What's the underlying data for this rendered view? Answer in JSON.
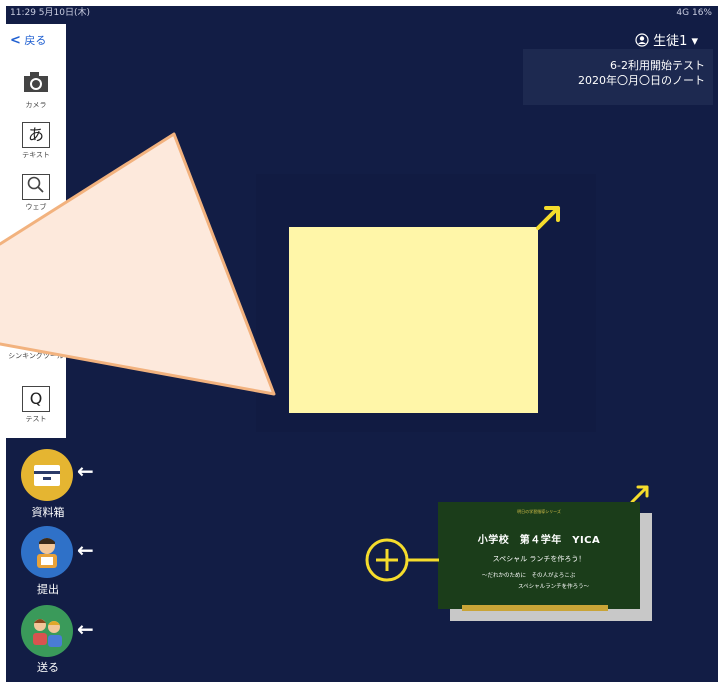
{
  "status": {
    "time": "11:29 5月10日(木)",
    "right": "4G 16%"
  },
  "nav": {
    "back": "戻る"
  },
  "user": {
    "name": "生徒1 ▾"
  },
  "note": {
    "title": "6-2利用開始テスト",
    "date": "2020年〇月〇日のノート"
  },
  "tools": [
    {
      "label": "カメラ",
      "icon": "camera-icon"
    },
    {
      "label": "テキスト",
      "icon": "text-a-icon"
    },
    {
      "label": "ウェブ",
      "icon": "magnifier-icon"
    },
    {
      "label": "シンキングツール",
      "icon": "thinking-tool-icon"
    },
    {
      "label": "テスト",
      "icon": "test-q-icon"
    }
  ],
  "text_icon_glyph": "あ",
  "test_icon_glyph": "Q",
  "actions": {
    "materials": "資料箱",
    "submit": "提出",
    "send": "送る"
  },
  "slide": {
    "series": "明日の学習指導シリーズ",
    "title": "小学校　第４学年　YICA",
    "subtitle": "スペシャル ランチを作ろう！",
    "line1": "〜だれかのために　その人がよろこぶ",
    "line2": "スペシャルランチを作ろう〜"
  },
  "colors": {
    "background": "#121d45",
    "sticky": "#fff6a8",
    "accent_yellow": "#f5dc2c",
    "callout": "#fde9dc",
    "callout_border": "#f2b27e"
  }
}
